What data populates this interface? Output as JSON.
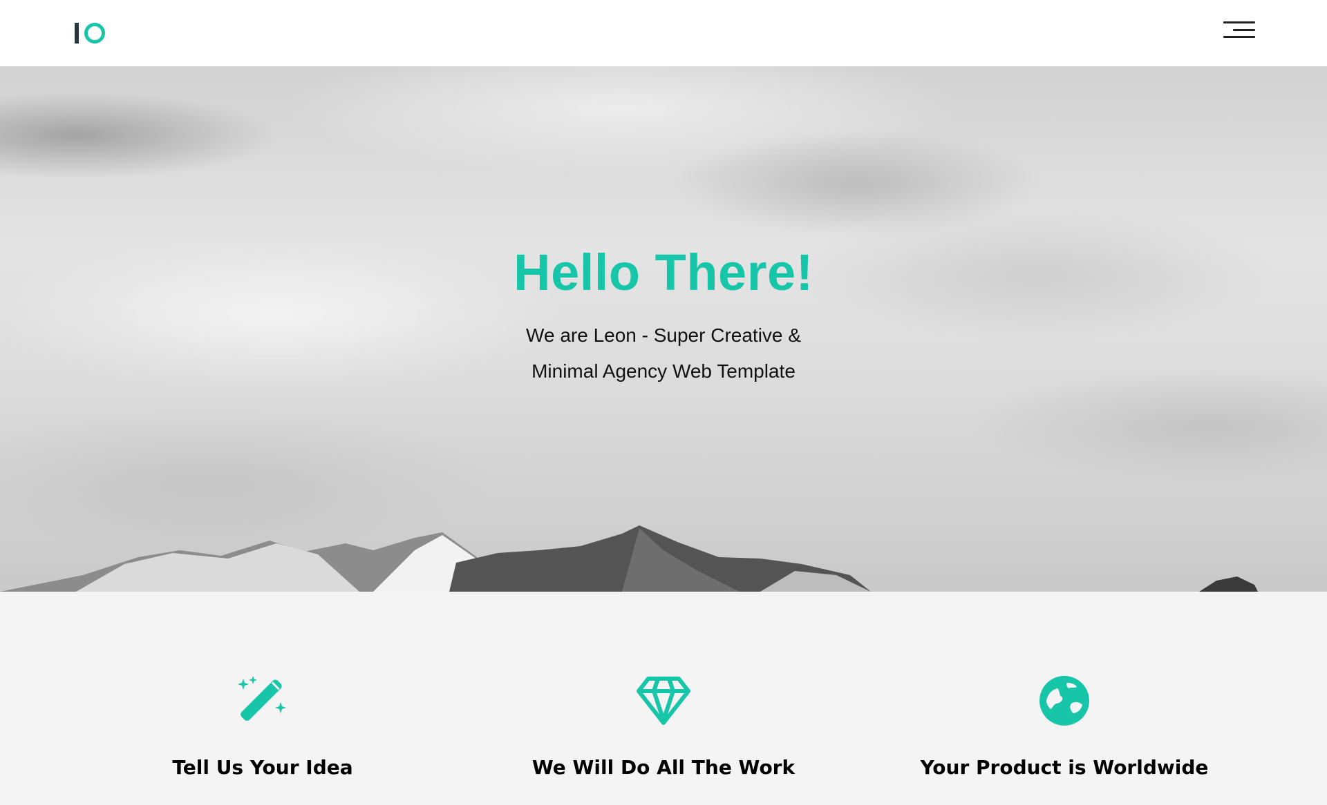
{
  "header": {
    "logo": {
      "name": "logo-mark",
      "bar_color": "#23373d",
      "ring_color": "#17c5a8"
    },
    "menu": {
      "icon": "hamburger-menu-icon"
    }
  },
  "hero": {
    "title": "Hello There!",
    "subtitle_line1": "We are Leon - Super Creative &",
    "subtitle_line2": "Minimal Agency Web Template",
    "accent_color": "#17c5a8",
    "background": "grayscale clouds and snowy mountains"
  },
  "features": [
    {
      "icon": "magic-wand-icon",
      "title": "Tell Us Your Idea"
    },
    {
      "icon": "diamond-icon",
      "title": "We Will Do All The Work"
    },
    {
      "icon": "globe-icon",
      "title": "Your Product is Worldwide"
    }
  ],
  "colors": {
    "accent": "#17c5a8",
    "dark": "#23373d",
    "features_bg": "#f4f4f4"
  }
}
